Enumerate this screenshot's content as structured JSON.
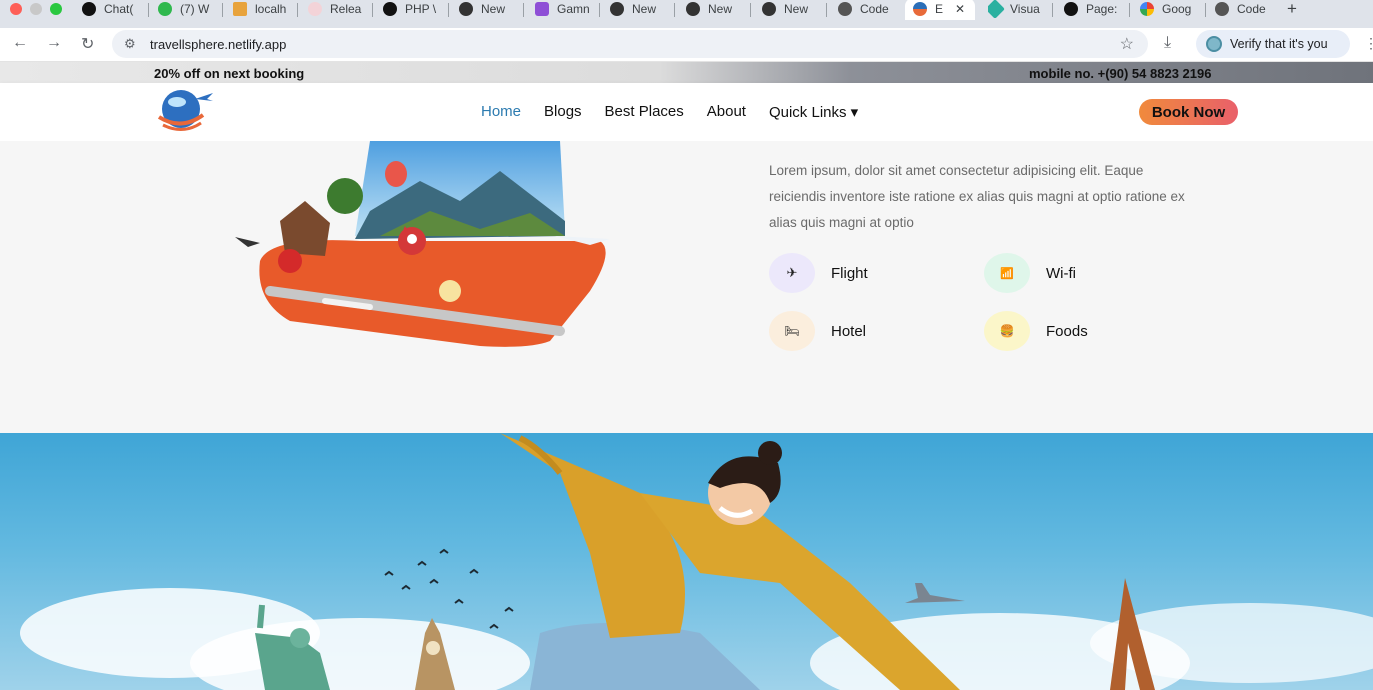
{
  "browser": {
    "tabs": [
      {
        "label": "Chat(",
        "icon": "openai-icon"
      },
      {
        "label": "(7) W",
        "icon": "whatsapp-icon"
      },
      {
        "label": "localh",
        "icon": "localhost-icon"
      },
      {
        "label": "Relea",
        "icon": "release-icon"
      },
      {
        "label": "PHP \\",
        "icon": "openai-icon"
      },
      {
        "label": "New",
        "icon": "openai-icon"
      },
      {
        "label": "Gamn",
        "icon": "gamma-icon"
      },
      {
        "label": "New",
        "icon": "openai-icon"
      },
      {
        "label": "New",
        "icon": "openai-icon"
      },
      {
        "label": "New",
        "icon": "openai-icon"
      },
      {
        "label": "Code",
        "icon": "code-icon"
      },
      {
        "label": "E",
        "icon": "site-logo-icon",
        "active": true
      },
      {
        "label": "Visua",
        "icon": "diamond-icon"
      },
      {
        "label": "Page:",
        "icon": "github-icon"
      },
      {
        "label": "Goog",
        "icon": "google-icon"
      },
      {
        "label": "Code",
        "icon": "code-icon"
      }
    ],
    "close_glyph": "✕",
    "new_tab_glyph": "+",
    "url": "travellsphere.netlify.app",
    "verify_label": "Verify that it's you"
  },
  "site": {
    "offer_text": "20% off on next booking",
    "phone_text": "mobile no. +(90) 54 8823 2196",
    "nav": [
      {
        "label": "Home",
        "active": true
      },
      {
        "label": "Blogs"
      },
      {
        "label": "Best Places"
      },
      {
        "label": "About"
      },
      {
        "label": "Quick Links ▾"
      }
    ],
    "book_label": "Book Now",
    "about": {
      "description": "Lorem ipsum, dolor sit amet consectetur adipisicing elit. Eaque reiciendis inventore iste ratione ex alias quis magni at optio ratione ex alias quis magni at optio",
      "features": [
        {
          "label": "Flight",
          "icon": "✈",
          "color": "#ece8fb"
        },
        {
          "label": "Wi-fi",
          "icon": "📶",
          "color": "#dff6ea"
        },
        {
          "label": "Hotel",
          "icon": "🛏",
          "color": "#fbeedd"
        },
        {
          "label": "Foods",
          "icon": "🍔",
          "color": "#fbf6c9"
        }
      ]
    }
  },
  "colors": {
    "accent": "#2c7bb0",
    "book_gradient_start": "#f08a3c",
    "book_gradient_end": "#e9606a",
    "sky": "#3fa5d6"
  }
}
